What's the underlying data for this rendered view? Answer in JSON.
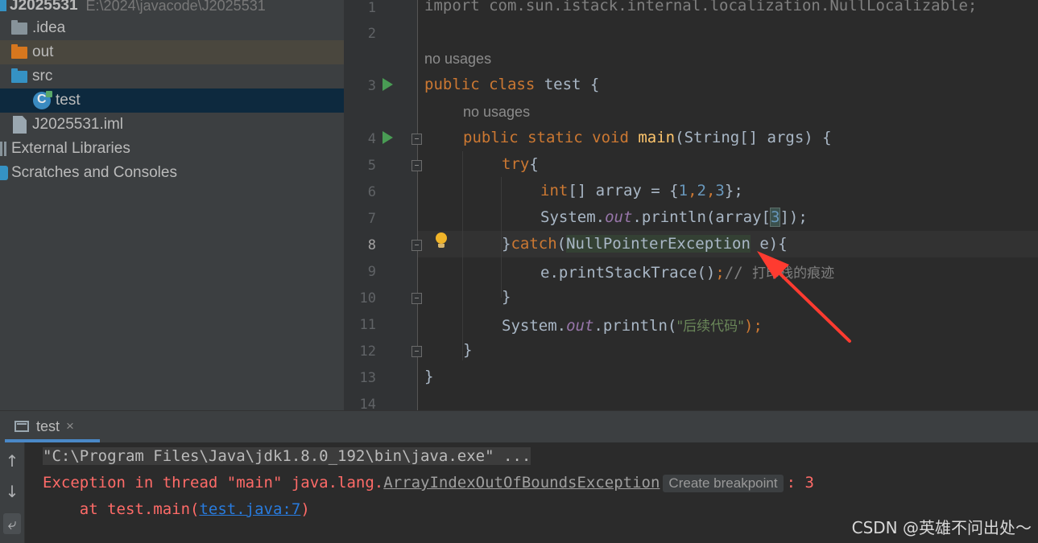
{
  "project_tree": {
    "root_name": "J2025531",
    "root_path": "E:\\2024\\javacode\\J2025531",
    "items": [
      {
        "label": ".idea",
        "icon": "folder-icon"
      },
      {
        "label": "out",
        "icon": "folder-excluded-icon"
      },
      {
        "label": "src",
        "icon": "folder-source-icon"
      },
      {
        "label": "test",
        "icon": "java-class-icon"
      },
      {
        "label": "J2025531.iml",
        "icon": "module-file-icon"
      },
      {
        "label": "External Libraries",
        "icon": "library-icon"
      },
      {
        "label": "Scratches and Consoles",
        "icon": "scratch-icon"
      }
    ]
  },
  "editor": {
    "usage_hint_1": "no usages",
    "usage_hint_2": "no usages",
    "line_numbers": [
      "1",
      "2",
      "3",
      "4",
      "5",
      "6",
      "7",
      "8",
      "9",
      "10",
      "11",
      "12",
      "13",
      "14"
    ],
    "code": {
      "l1_import": "import com.sun.istack.internal.localization.NullLocalizable;",
      "l3_kw": "public class",
      "l3_name": " test {",
      "l4_kw": "public static void",
      "l4_fn": "main",
      "l4_rest": "(String[] args) {",
      "l5_kw": "try",
      "l5_rest": "{",
      "l6_kw": "int",
      "l6_a": "[] array = {",
      "l6_n1": "1",
      "l6_c1": ",",
      "l6_n2": "2",
      "l6_c2": ",",
      "l6_n3": "3",
      "l6_end": "};",
      "l7_a": "System.",
      "l7_fld": "out",
      "l7_b": ".println(array[",
      "l7_idx": "3",
      "l7_end": "]);",
      "l8_a": "}",
      "l8_kw": "catch",
      "l8_paren": "(",
      "l8_exc": "NullPointerException",
      "l8_rest": " e){",
      "l9_a": "e.printStackTrace()",
      "l9_semi": ";",
      "l9_cmt": "// ",
      "l9_cmt_text": "打印栈的痕迹",
      "l10": "}",
      "l11_a": "System.",
      "l11_fld": "out",
      "l11_b": ".println(",
      "l11_str": "\"后续代码\"",
      "l11_end": ");",
      "l12": "}",
      "l13": "}"
    }
  },
  "run_panel": {
    "tab_label": "test",
    "close_glyph": "×",
    "side_buttons": {
      "up": "↑",
      "down": "↓",
      "wrap": "⤶"
    },
    "console": {
      "command": "\"C:\\Program Files\\Java\\jdk1.8.0_192\\bin\\java.exe\" ...",
      "exc_prefix": "Exception in thread \"main\" java.lang.",
      "exc_class": "ArrayIndexOutOfBoundsException",
      "breakpoint_button": "Create breakpoint",
      "exc_suffix": ": 3",
      "at_prefix": "    at test.main(",
      "at_link": "test.java:7",
      "at_suffix": ")"
    }
  },
  "watermark": "CSDN @英雄不问出处～",
  "colors": {
    "keyword": "#cc7832",
    "method": "#ffc66d",
    "number": "#6897bb",
    "field": "#9876aa",
    "string": "#6a8759",
    "error": "#ff6b68",
    "link": "#287bde",
    "annotation_arrow": "#ff3b30"
  }
}
